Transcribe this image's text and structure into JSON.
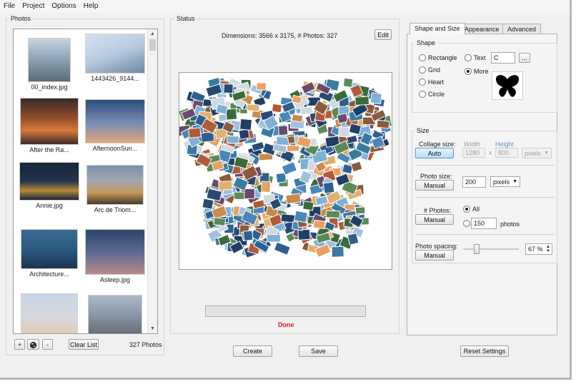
{
  "menu": [
    "File",
    "Project",
    "Options",
    "Help"
  ],
  "photos_panel": {
    "title": "Photos",
    "items": [
      {
        "label": "00_index.jpg",
        "colors": [
          "#8fa6b8",
          "#5d6a74"
        ]
      },
      {
        "label": "1443426_9144...",
        "colors": [
          "#b7cbdf",
          "#6d86a3"
        ]
      },
      {
        "label": "After the Ra...",
        "colors": [
          "#3a2a2a",
          "#d67a3a"
        ]
      },
      {
        "label": "AfternoonSun...",
        "colors": [
          "#2b4d7a",
          "#e0a47a"
        ]
      },
      {
        "label": "Annie.jpg",
        "colors": [
          "#18263b",
          "#b88a3a"
        ]
      },
      {
        "label": "Arc de Triom...",
        "colors": [
          "#7a8fab",
          "#c49a58"
        ]
      },
      {
        "label": "Architecture...",
        "colors": [
          "#2c5a80",
          "#1b3550"
        ]
      },
      {
        "label": "Asleep.jpg",
        "colors": [
          "#2d4468",
          "#b98a8a"
        ]
      },
      {
        "label": "",
        "colors": [
          "#c8d6e6",
          "#e0c9b4"
        ]
      },
      {
        "label": "",
        "colors": [
          "#a9b8c8",
          "#646e78"
        ]
      }
    ],
    "add_label": "+",
    "globe_icon": "globe-icon",
    "remove_label": "-",
    "clear_label": "Clear List",
    "count_text": "327 Photos"
  },
  "status_panel": {
    "title": "Status",
    "dimensions_text": "Dimensions: 3566 x 3175, # Photos: 327",
    "edit_label": "Edit",
    "done_text": "Done",
    "done_color": "#e02020",
    "progress": 0
  },
  "bottom": {
    "create_label": "Create",
    "save_label": "Save",
    "reset_label": "Reset Settings"
  },
  "tabs": [
    "Shape and Size",
    "Appearance",
    "Advanced"
  ],
  "shape": {
    "title": "Shape",
    "options": [
      "Rectangle",
      "Grid",
      "Heart",
      "Circle"
    ],
    "text_label": "Text",
    "text_value": "C",
    "browse_label": "...",
    "more_label": "More",
    "selected": "More",
    "preview_icon": "butterfly-icon"
  },
  "size": {
    "title": "Size",
    "collage_label": "Collage size:",
    "collage_button": "Auto",
    "width_label": "Width",
    "height_label": "Height",
    "width_value": "1280",
    "times": "x",
    "height_value": "800",
    "collage_unit": "pixels",
    "photo_size_label": "Photo size:",
    "photo_size_button": "Manual",
    "photo_size_value": "200",
    "photo_size_unit": "pixels",
    "photos_label": "# Photos:",
    "photos_button": "Manual",
    "all_label": "All",
    "photos_value": "150",
    "photos_unit": "photos",
    "spacing_label": "Photo spacing:",
    "spacing_button": "Manual",
    "spacing_value": "67 %",
    "spacing_fraction": 0.67
  }
}
